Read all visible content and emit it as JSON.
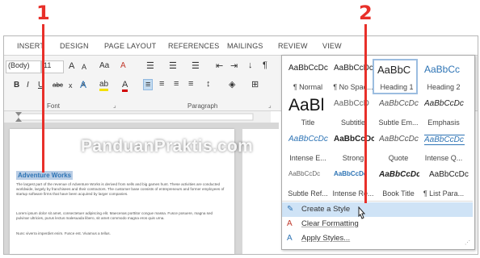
{
  "callouts": {
    "one": "1",
    "two": "2"
  },
  "tabs": [
    "INSERT",
    "DESIGN",
    "PAGE LAYOUT",
    "REFERENCES",
    "MAILINGS",
    "REVIEW",
    "VIEW"
  ],
  "font": {
    "name": "(Body)",
    "size": "11",
    "grow": "A",
    "shrink": "A",
    "case": "Aa",
    "clear": "A",
    "bold": "B",
    "italic": "I",
    "underline": "U",
    "strike": "abc",
    "subscript": "x",
    "superscript": "x",
    "effects": "A",
    "highlight": "ab",
    "color": "A"
  },
  "groups": {
    "font": "Font",
    "paragraph": "Paragraph"
  },
  "gallery": {
    "rows": [
      [
        {
          "preview": "AaBbCcDc",
          "label": "¶ Normal"
        },
        {
          "preview": "AaBbCcDc",
          "label": "¶ No Spac..."
        },
        {
          "preview": "AaBbC",
          "label": "Heading 1"
        },
        {
          "preview": "AaBbCc",
          "label": "Heading 2"
        }
      ],
      [
        {
          "preview": "AaBl",
          "label": "Title"
        },
        {
          "preview": "AaBbCcD",
          "label": "Subtitle"
        },
        {
          "preview": "AaBbCcDc",
          "label": "Subtle Em..."
        },
        {
          "preview": "AaBbCcDc",
          "label": "Emphasis"
        }
      ],
      [
        {
          "preview": "AaBbCcDc",
          "label": "Intense E..."
        },
        {
          "preview": "AaBbCcDc",
          "label": "Strong"
        },
        {
          "preview": "AaBbCcDc",
          "label": "Quote"
        },
        {
          "preview": "AaBbCcDc",
          "label": "Intense Q..."
        }
      ],
      [
        {
          "preview": "AaBbCcDc",
          "label": "Subtle Ref..."
        },
        {
          "preview": "AaBbCcDc",
          "label": "Intense Re..."
        },
        {
          "preview": "AaBbCcDc",
          "label": "Book Title"
        },
        {
          "preview": "AaBbCcDc",
          "label": "¶ List Para..."
        }
      ]
    ],
    "menu": {
      "create": "Create a Style",
      "clear": "Clear Formatting",
      "apply": "Apply Styles..."
    }
  },
  "document": {
    "title": "Adventure Works",
    "p1": "The largest part of the revenue of Adventure Works is derived from sells and big games hunt. These activities are conducted worldwide, largely by franchisees and their contractors. The customer base consists of entrepreneurs and former employees of startup software firms that have been acquired by larger companies.",
    "p2": "Lorem ipsum dolor sit amet, consectetuer adipiscing elit. Maecenas porttitor congue massa. Fusce posuere, magna sed pulvinar ultricies, purus lectus malesuada libero, sit amet commodo magna eros quis urna.",
    "p3": "Nunc viverra imperdiet enim. Fusce est. Vivamus a tellus."
  },
  "watermark": "PanduanPraktis.com",
  "colors": {
    "accent": "#2e74b5",
    "callout": "#e8302a",
    "selection": "#cfe3f6"
  }
}
